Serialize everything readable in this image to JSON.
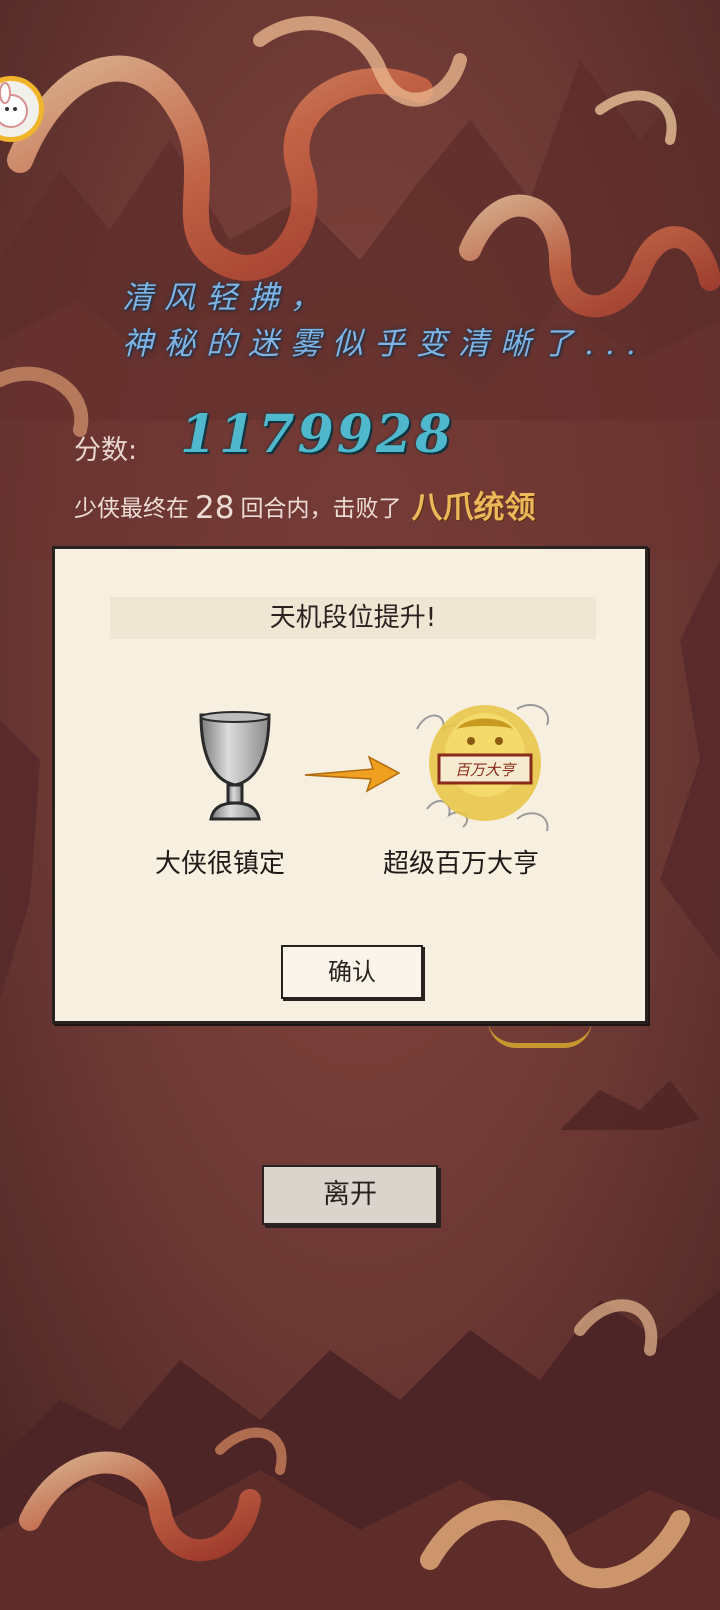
{
  "poem": {
    "line1": "清风轻拂，",
    "line2": "神秘的迷雾似乎变清晰了..."
  },
  "score": {
    "label": "分数:",
    "value": "1179928"
  },
  "result": {
    "prefix": "少侠最终在",
    "rounds": "28",
    "middle": "回合内，击败了",
    "boss": "八爪统领"
  },
  "dialog": {
    "title": "天机段位提升!",
    "from_rank": "大侠很镇定",
    "to_rank": "超级百万大亨",
    "badge_text": "百万大亨",
    "confirm_label": "确认"
  },
  "leave_label": "离开",
  "colors": {
    "background": "#6e3a35",
    "dialog_bg": "#f7f0e1",
    "score_color": "#4fb8cc",
    "poem_color": "#7fb3e3",
    "boss_color": "#ecb85a",
    "arrow_color": "#f0a020"
  }
}
